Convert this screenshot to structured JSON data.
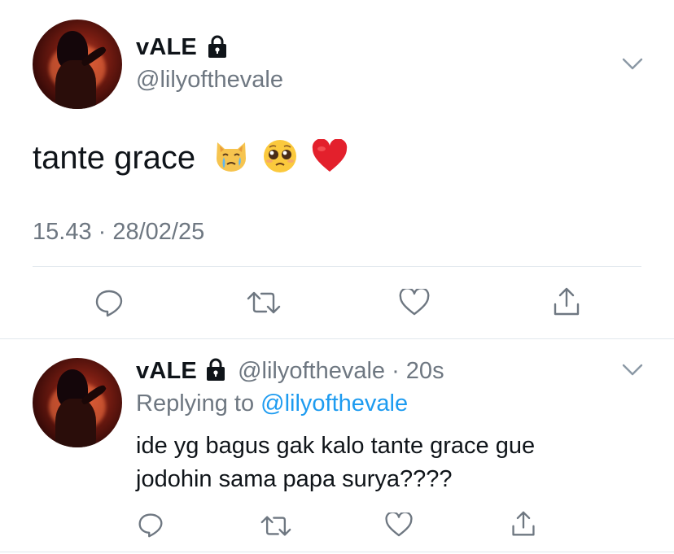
{
  "main_tweet": {
    "display_name": "vALE",
    "handle": "@lilyofthevale",
    "text": "tante grace",
    "emojis": [
      "crying-cat-face",
      "pleading-face",
      "red-heart"
    ],
    "timestamp": "15.43 · 28/02/25"
  },
  "reply_tweet": {
    "display_name": "vALE",
    "handle": "@lilyofthevale",
    "age": "· 20s",
    "replying_prefix": "Replying to",
    "replying_to": "@lilyofthevale",
    "text_line1": "ide yg bagus gak kalo tante grace gue",
    "text_line2": "jodohin sama papa surya????"
  },
  "colors": {
    "secondary_text": "#6e7781",
    "link": "#1d9bf0",
    "divider": "#e1e8ed",
    "icon": "#6e7781"
  },
  "icons": [
    "lock-icon",
    "chevron-down-icon",
    "reply-icon",
    "retweet-icon",
    "like-icon",
    "share-icon"
  ]
}
